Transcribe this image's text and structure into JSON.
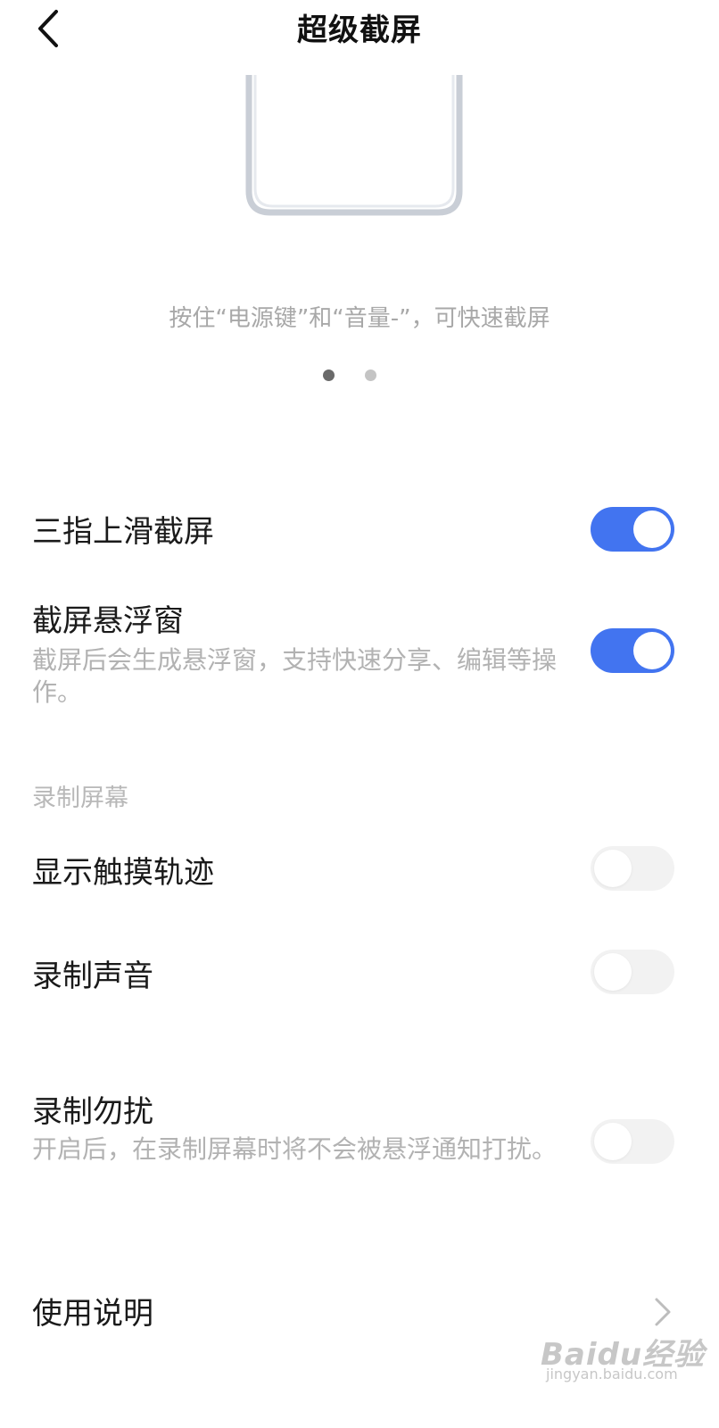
{
  "header": {
    "title": "超级截屏",
    "back_icon": "chevron-left-icon"
  },
  "illustration": {
    "hint": "按住“电源键”和“音量-”，可快速截屏",
    "pages_total": 2,
    "page_active": 1
  },
  "settings": {
    "three_finger": {
      "title": "三指上滑截屏",
      "enabled": true
    },
    "floating_window": {
      "title": "截屏悬浮窗",
      "desc": "截屏后会生成悬浮窗，支持快速分享、编辑等操作。",
      "enabled": true
    },
    "record_section": {
      "header": "录制屏幕"
    },
    "touch_trace": {
      "title": "显示触摸轨迹",
      "enabled": false
    },
    "record_sound": {
      "title": "录制声音",
      "enabled": false
    },
    "dnd": {
      "title": "录制勿扰",
      "desc": "开启后，在录制屏幕时将不会被悬浮通知打扰。",
      "enabled": false
    },
    "instructions": {
      "title": "使用说明",
      "icon": "chevron-right-icon"
    }
  },
  "colors": {
    "accent": "#4274f0",
    "toggle_off": "#f2f2f2",
    "secondary_text": "#b2b2b2"
  },
  "watermark": {
    "main": "Baidu经验",
    "sub": "jingyan.baidu.com"
  }
}
